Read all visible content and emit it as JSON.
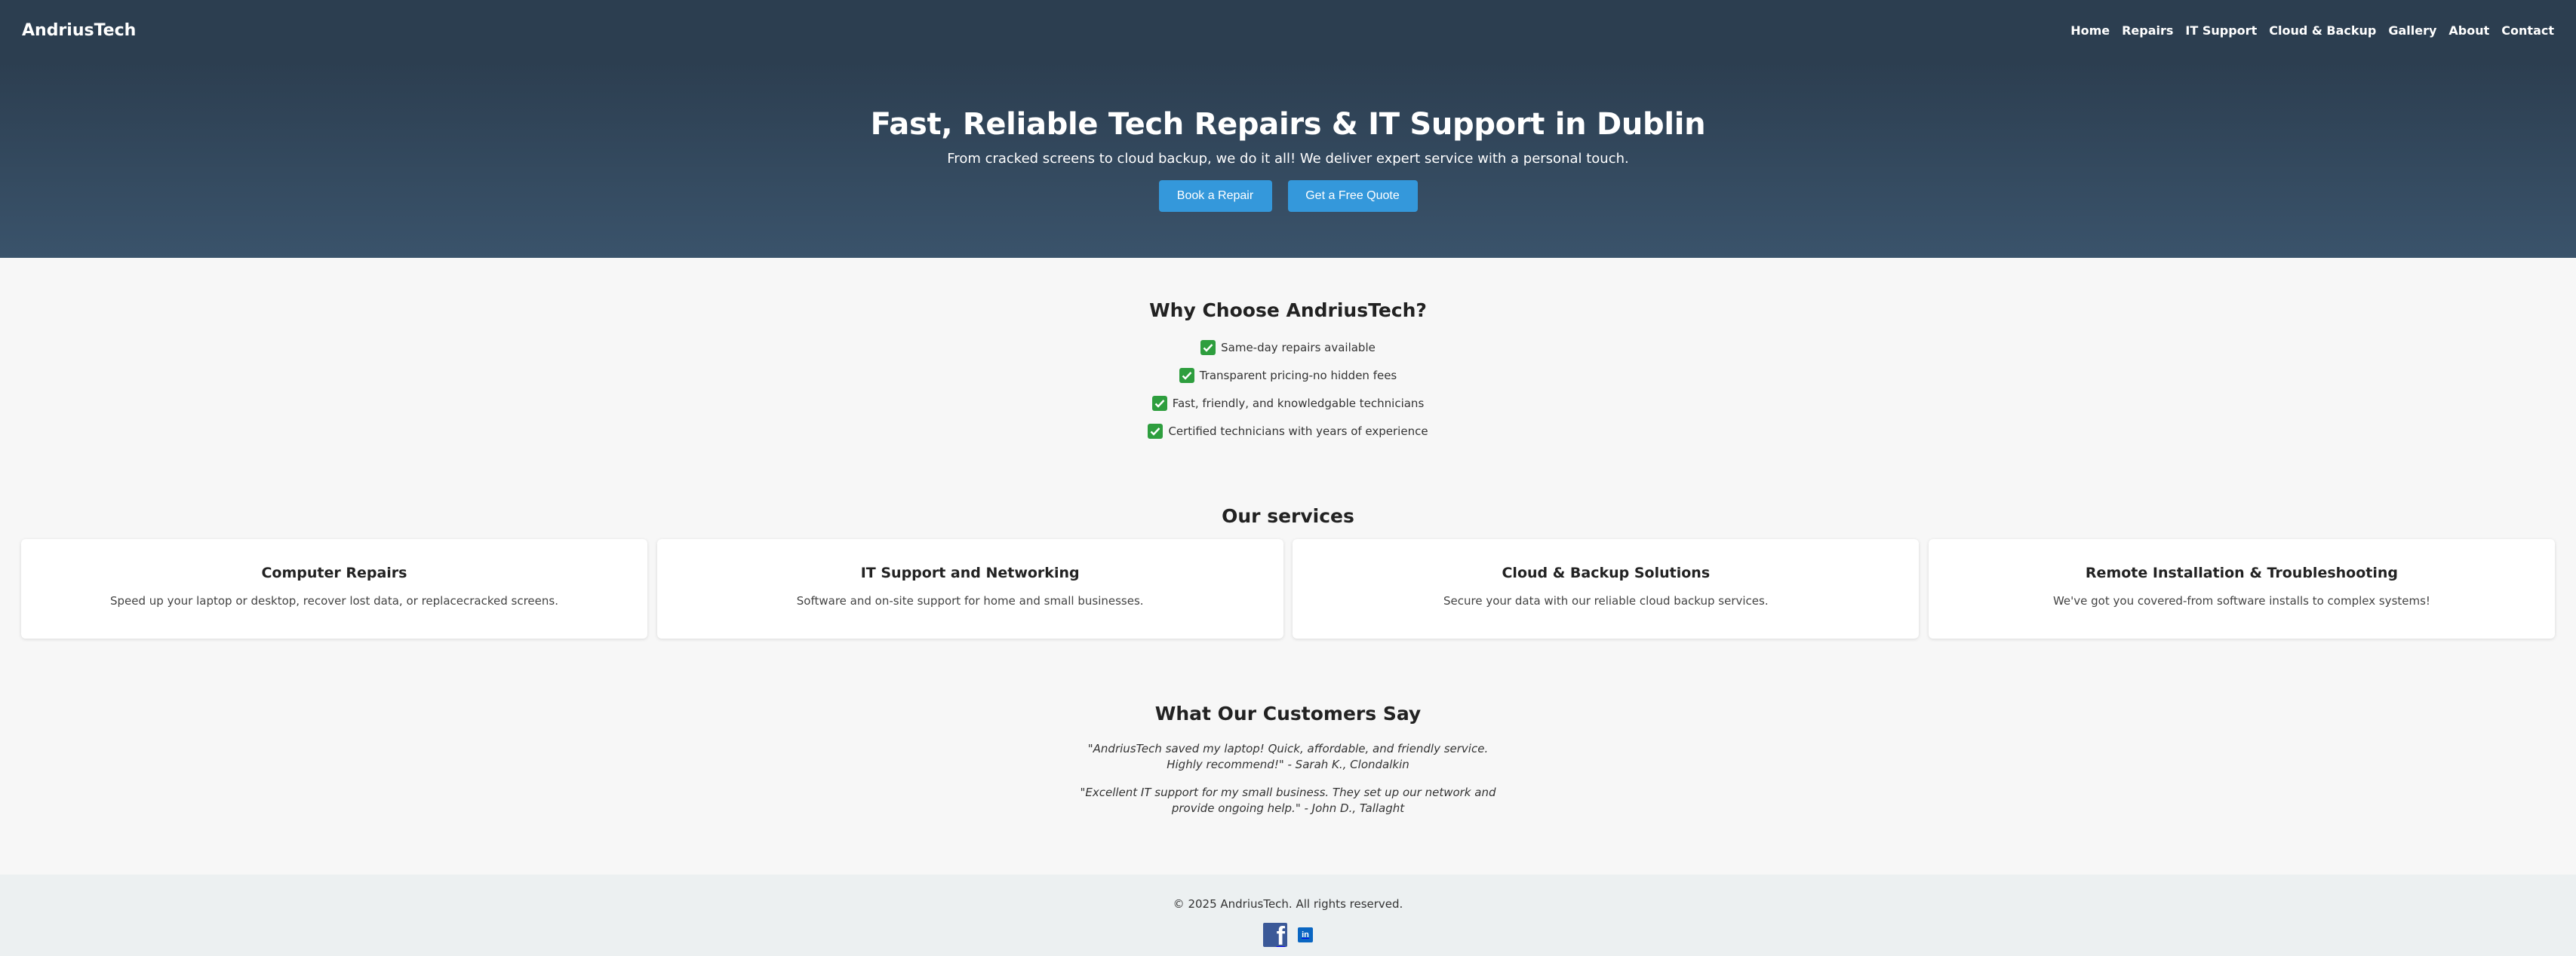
{
  "header": {
    "brand": "AndriusTech",
    "nav": [
      "Home",
      "Repairs",
      "IT Support",
      "Cloud & Backup",
      "Gallery",
      "About",
      "Contact"
    ]
  },
  "hero": {
    "title": "Fast, Reliable Tech Repairs & IT Support in Dublin",
    "subtitle": "From cracked screens to cloud backup, we do it all! We deliver expert service with a personal touch.",
    "book_label": "Book a Repair",
    "quote_label": "Get a Free Quote"
  },
  "why": {
    "title": "Why Choose AndriusTech?",
    "items": [
      "Same-day repairs available",
      "Transparent pricing-no hidden fees",
      "Fast, friendly, and knowledgable technicians",
      "Certified technicians with years of experience"
    ]
  },
  "services": {
    "title": "Our services",
    "cards": [
      {
        "title": "Computer Repairs",
        "text": "Speed up your laptop or desktop, recover lost data, or replacecracked screens."
      },
      {
        "title": "IT Support and Networking",
        "text": "Software and on-site support for home and small businesses."
      },
      {
        "title": "Cloud & Backup Solutions",
        "text": "Secure your data with our reliable cloud backup services."
      },
      {
        "title": "Remote Installation & Troubleshooting",
        "text": "We've got you covered-from software installs to complex systems!"
      }
    ]
  },
  "testimonials": {
    "title": "What Our Customers Say",
    "quotes": [
      "\"AndriusTech saved my laptop! Quick, affordable, and friendly service. Highly recommend!\" - Sarah K., Clondalkin",
      "\"Excellent IT support for my small business. They set up our network and provide ongoing help.\" - John D., Tallaght"
    ]
  },
  "footer": {
    "copyright": "© 2025 AndriusTech. All rights reserved.",
    "social_icons": [
      "facebook-icon",
      "linkedin-icon"
    ],
    "linkedin_glyph": "in",
    "facebook_glyph": "f"
  },
  "colors": {
    "header_bg": "#2c3e50",
    "button": "#3498db",
    "check": "#2e9e3e",
    "footer_bg": "#ecf0f1"
  }
}
